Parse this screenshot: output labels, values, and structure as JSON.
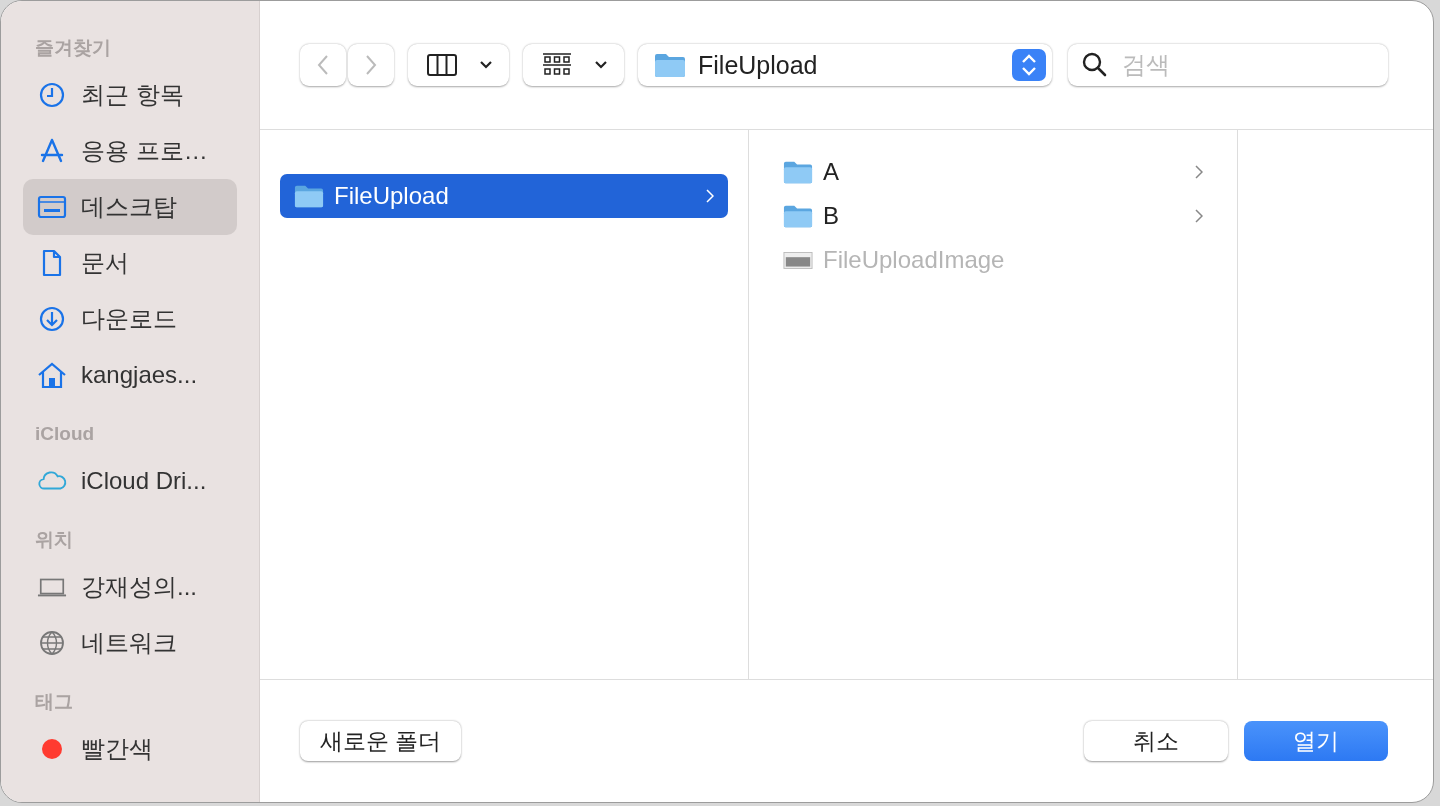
{
  "sidebar": {
    "sections": [
      {
        "heading": "즐겨찾기",
        "items": [
          {
            "label": "최근 항목",
            "kind": "clock",
            "selected": false
          },
          {
            "label": "응용 프로…",
            "kind": "apps",
            "selected": false
          },
          {
            "label": "데스크탑",
            "kind": "desktop",
            "selected": true
          },
          {
            "label": "문서",
            "kind": "document",
            "selected": false
          },
          {
            "label": "다운로드",
            "kind": "download",
            "selected": false
          },
          {
            "label": "kangjaes...",
            "kind": "home",
            "selected": false
          }
        ]
      },
      {
        "heading": "iCloud",
        "items": [
          {
            "label": "iCloud Dri...",
            "kind": "cloud",
            "selected": false
          }
        ]
      },
      {
        "heading": "위치",
        "items": [
          {
            "label": "강재성의...",
            "kind": "laptop",
            "selected": false
          },
          {
            "label": "네트워크",
            "kind": "globe",
            "selected": false
          }
        ]
      },
      {
        "heading": "태그",
        "items": [
          {
            "label": "빨간색",
            "kind": "tag",
            "color": "#ff3b30",
            "selected": false
          }
        ]
      }
    ]
  },
  "toolbar": {
    "back": {
      "disabled": true
    },
    "forward": {
      "disabled": true
    },
    "path": "FileUpload",
    "search": {
      "placeholder": "검색"
    }
  },
  "columns": [
    {
      "items": [
        {
          "name": "FileUpload",
          "kind": "folder",
          "selected": true,
          "disabled": false,
          "expandable": true
        }
      ]
    },
    {
      "items": [
        {
          "name": "A",
          "kind": "folder",
          "selected": false,
          "disabled": false,
          "expandable": true
        },
        {
          "name": "B",
          "kind": "folder",
          "selected": false,
          "disabled": false,
          "expandable": true
        },
        {
          "name": "FileUploadImage",
          "kind": "file",
          "selected": false,
          "disabled": true,
          "expandable": false
        }
      ]
    }
  ],
  "buttons": [
    {
      "label": "새로운 폴더",
      "kind": "default"
    },
    {
      "label": "취소",
      "kind": "default"
    },
    {
      "label": "열기",
      "kind": "primary"
    }
  ]
}
